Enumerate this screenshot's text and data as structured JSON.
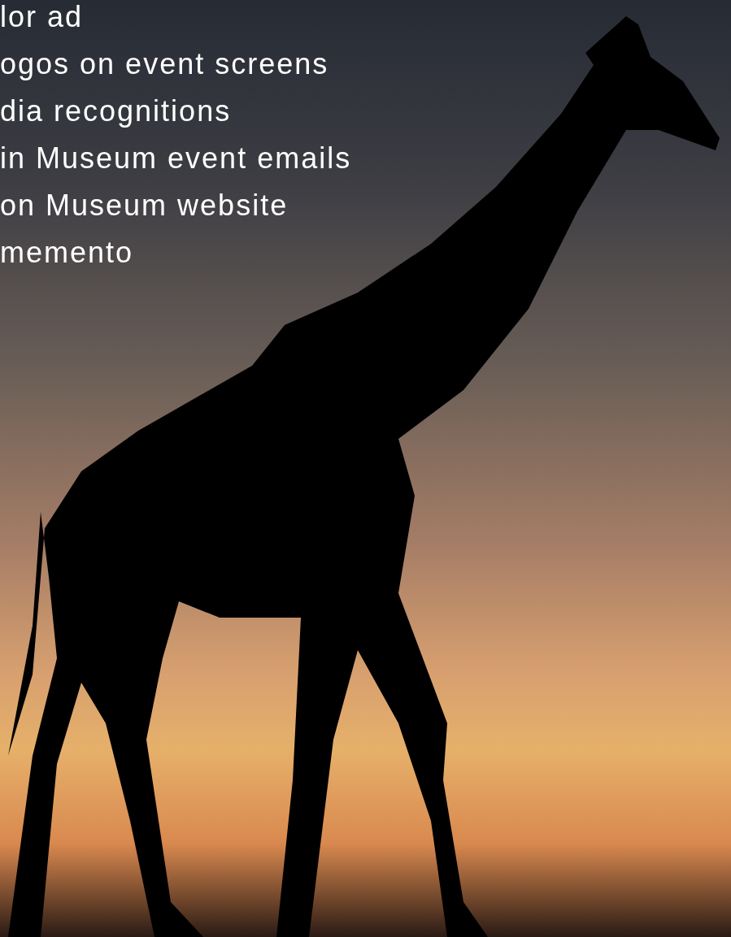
{
  "benefits": [
    "lor ad",
    "ogos on event screens",
    "dia recognitions",
    "in Museum event emails",
    "on Museum website",
    "memento"
  ]
}
